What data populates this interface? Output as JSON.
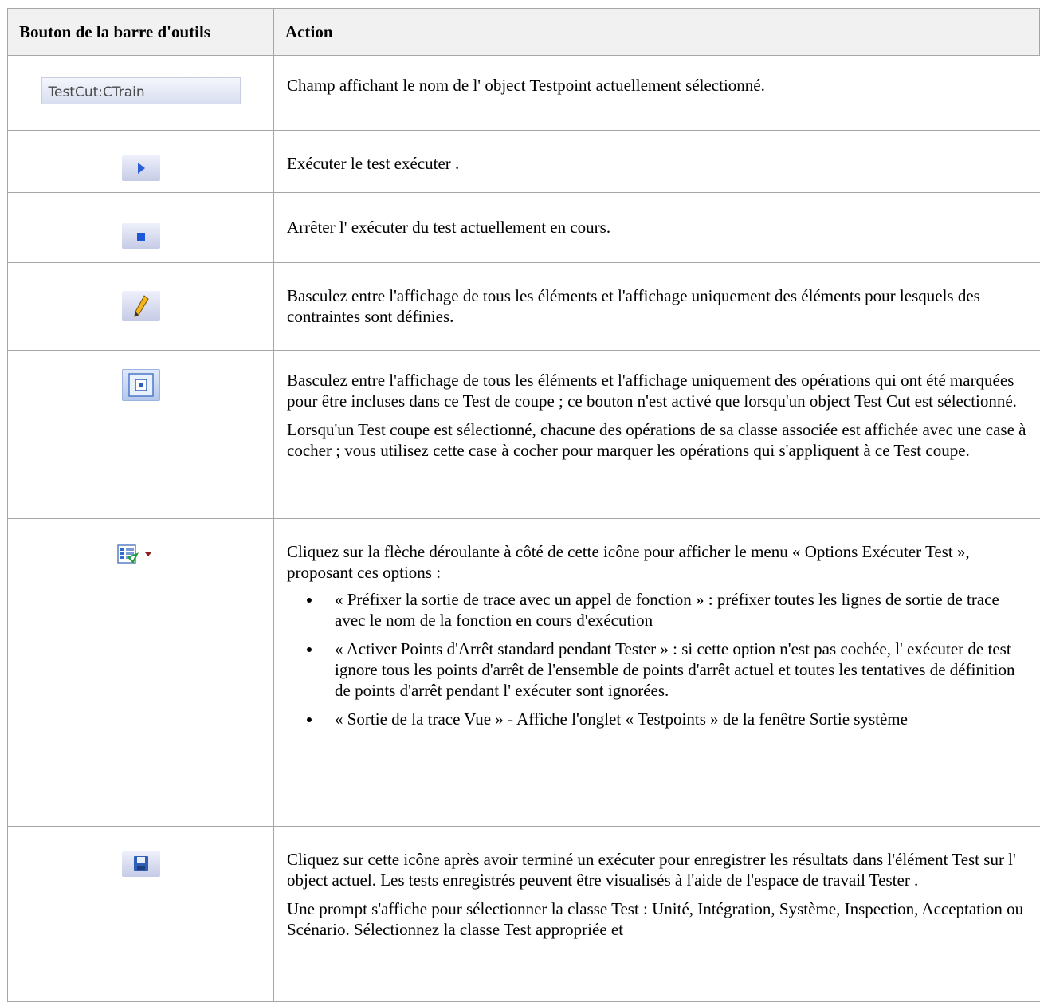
{
  "table": {
    "headers": {
      "button": "Bouton de la barre d'outils",
      "action": "Action"
    },
    "rows": [
      {
        "icon": "testpoint-name-field",
        "field_text": "TestCut:CTrain",
        "paragraphs": [
          "Champ affichant le nom de l' object Testpoint actuellement sélectionné."
        ]
      },
      {
        "icon": "run-play-icon",
        "paragraphs": [
          "Exécuter le test exécuter ."
        ]
      },
      {
        "icon": "stop-icon",
        "paragraphs": [
          "Arrêter l' exécuter du test actuellement en cours."
        ]
      },
      {
        "icon": "pencil-icon",
        "paragraphs": [
          "Basculez entre l'affichage de tous les éléments et l'affichage uniquement des éléments pour lesquels des contraintes sont définies."
        ]
      },
      {
        "icon": "toggle-frame-icon",
        "paragraphs": [
          "Basculez entre l'affichage de tous les éléments et l'affichage uniquement des opérations qui ont été marquées pour être incluses dans ce Test de coupe ; ce bouton n'est activé que lorsqu'un object Test Cut est sélectionné.",
          "Lorsqu'un Test coupe est sélectionné, chacune des opérations de sa classe associée est affichée avec une case à cocher ; vous utilisez cette case à cocher pour marquer les opérations qui s'appliquent à ce Test coupe."
        ]
      },
      {
        "icon": "options-dropdown-icon",
        "paragraphs": [
          "Cliquez sur la flèche déroulante à côté de cette icône pour afficher le menu « Options Exécuter Test », proposant ces options :"
        ],
        "bullets": [
          "« Préfixer la sortie de trace avec un appel de fonction » : préfixer toutes les lignes de sortie de trace avec le nom de la fonction en cours d'exécution",
          "« Activer Points d'Arrêt standard pendant Tester » : si cette option n'est pas cochée, l' exécuter de test ignore tous les points d'arrêt de l'ensemble de points d'arrêt actuel et toutes les tentatives de définition de points d'arrêt pendant l' exécuter sont ignorées.",
          "« Sortie de la trace Vue » - Affiche l'onglet « Testpoints » de la fenêtre Sortie système"
        ]
      },
      {
        "icon": "save-icon",
        "paragraphs": [
          "Cliquez sur cette icône après avoir terminé un exécuter pour enregistrer les résultats dans l'élément Test sur l' object actuel. Les tests enregistrés peuvent être visualisés à l'aide de l'espace de travail Tester .",
          "Une prompt s'affiche pour sélectionner la classe Test : Unité, Intégration, Système, Inspection, Acceptation ou Scénario. Sélectionnez la classe Test appropriée et"
        ]
      }
    ]
  }
}
